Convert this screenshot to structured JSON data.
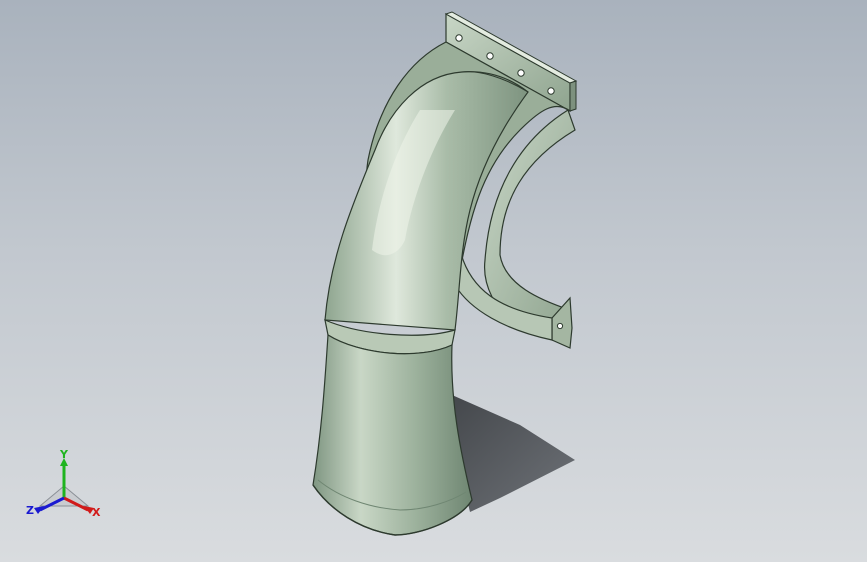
{
  "viewport": {
    "background_top": "#a9b2bd",
    "background_bottom": "#d9dcdf",
    "model": "curved-duct-with-flange-bracket"
  },
  "triad": {
    "y_label": "Y",
    "x_label": "X",
    "z_label": "Z",
    "colors": {
      "x": "#d11a1a",
      "y": "#1fb41f",
      "z": "#1a1ad1"
    }
  }
}
